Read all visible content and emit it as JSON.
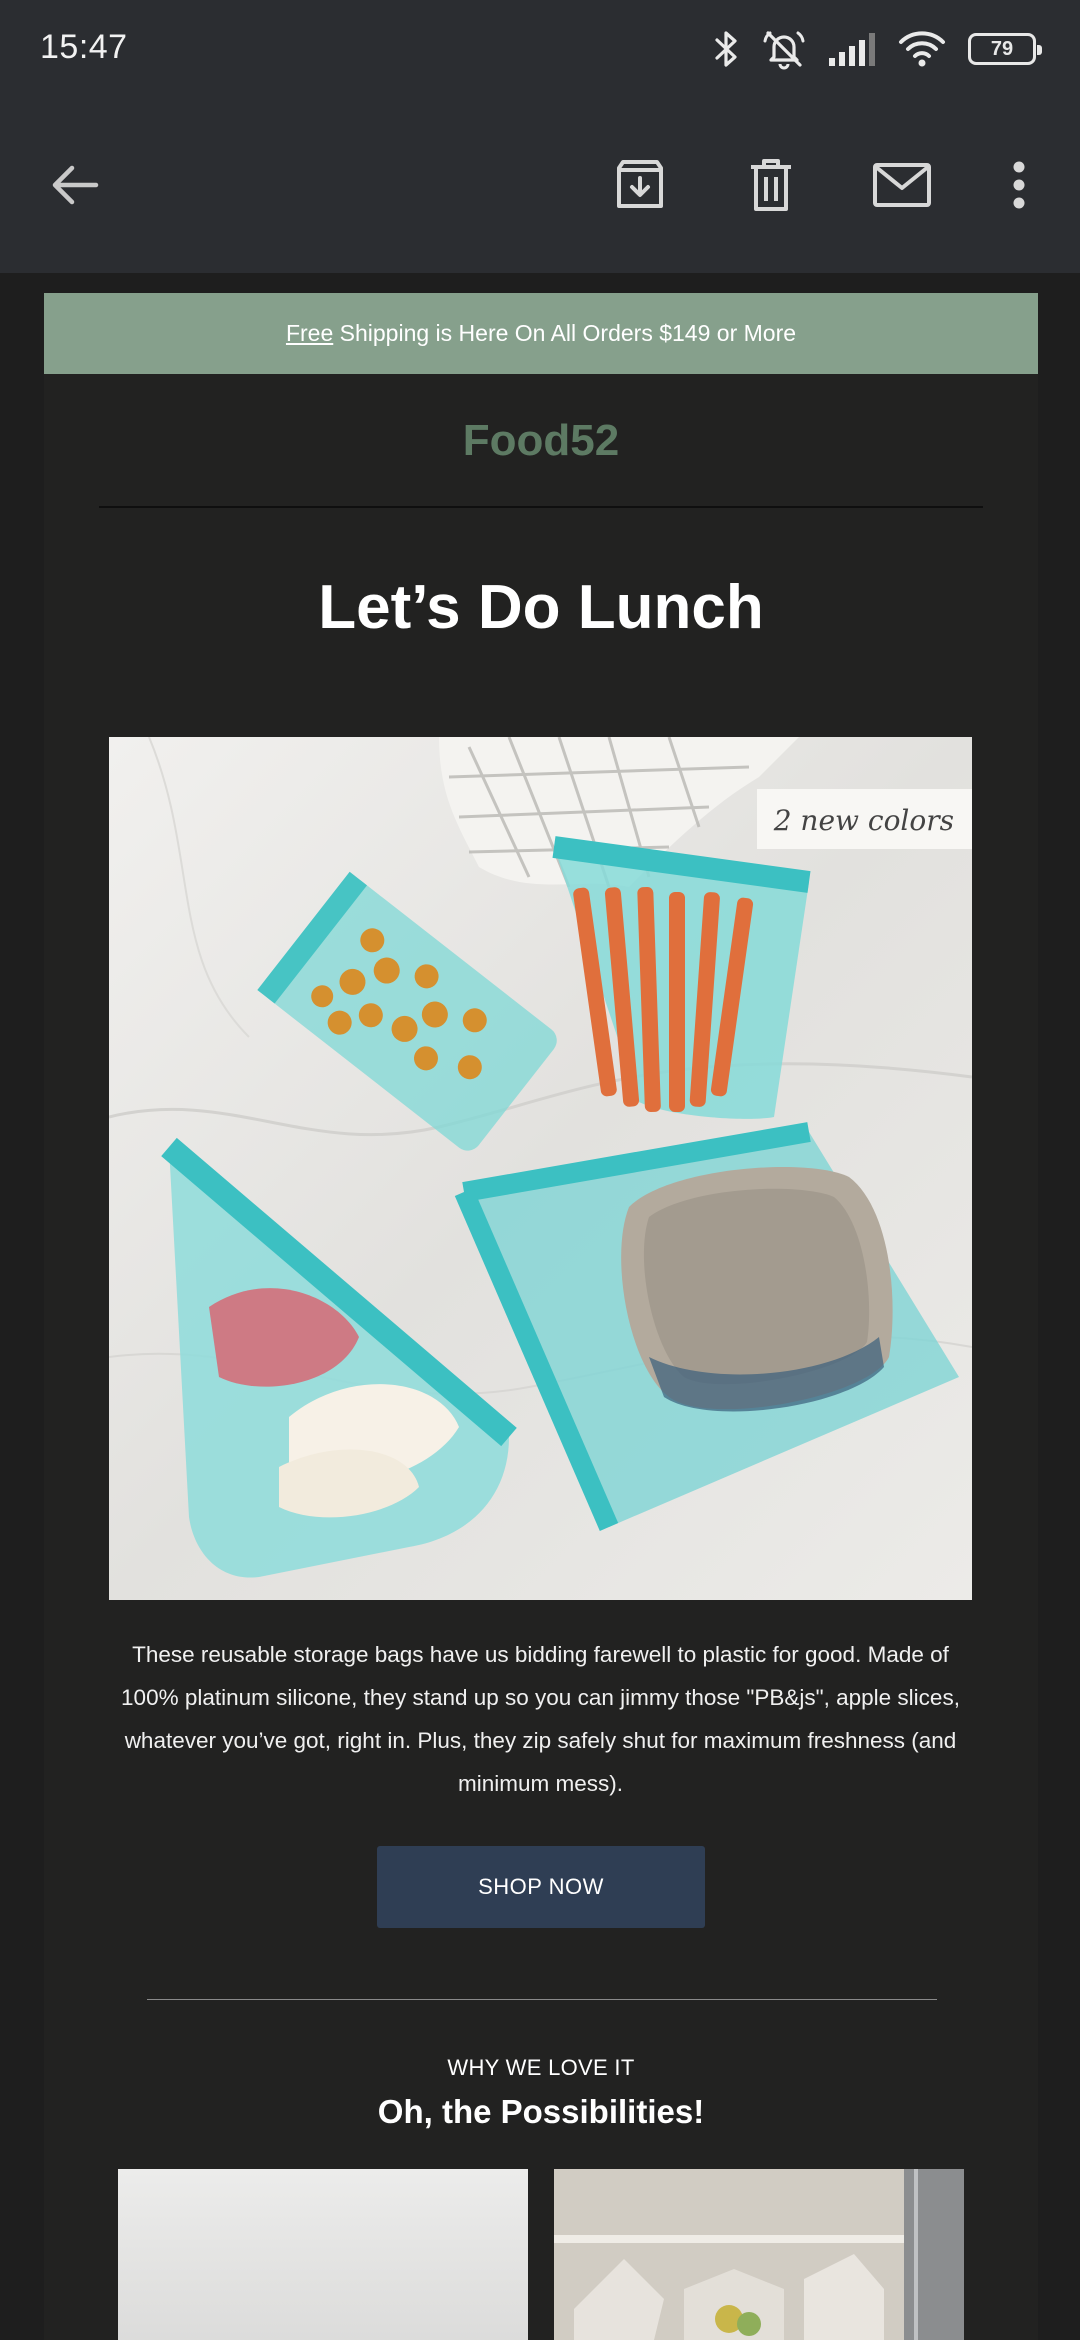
{
  "status_bar": {
    "time": "15:47",
    "battery_level": "79",
    "icons": [
      "bluetooth-icon",
      "bell-off-icon",
      "signal-icon",
      "wifi-icon",
      "battery-icon"
    ]
  },
  "toolbar": {
    "back_icon": "arrow-left-icon",
    "archive_icon": "archive-icon",
    "delete_icon": "trash-icon",
    "mark_unread_icon": "mail-icon",
    "more_icon": "more-vertical-icon"
  },
  "email": {
    "promo_link": "Free",
    "promo_text": " Shipping is Here On All Orders $149 or More",
    "brand": "Food52",
    "headline": "Let’s Do Lunch",
    "hero_badge": "2 new colors",
    "description": "These reusable storage bags have us bidding farewell to plastic for good. Made of 100% platinum silicone, they stand up so you can jimmy those \"PB&js\", apple slices, whatever you’ve got, right in. Plus, they zip safely shut for maximum freshness (and minimum mess).",
    "cta_label": "SHOP NOW",
    "section_kicker": "WHY WE LOVE IT",
    "section_title": "Oh, the Possibilities!"
  },
  "colors": {
    "toolbar_bg": "#2b2d31",
    "email_bg": "#222221",
    "promo_bg": "#86a08c",
    "brand": "#5d7a63",
    "cta_bg": "#2f3e54"
  }
}
